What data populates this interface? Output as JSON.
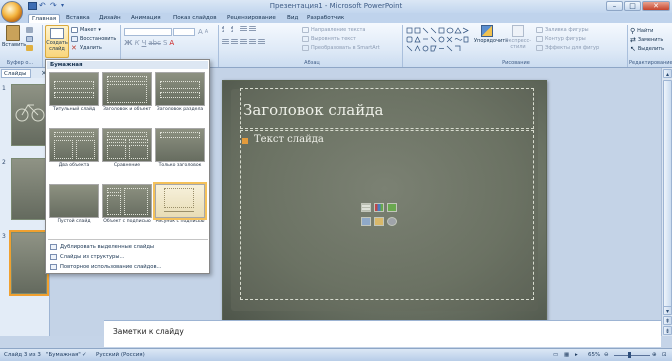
{
  "window": {
    "title": "Презентация1 - Microsoft PowerPoint",
    "controls": [
      "–",
      "□",
      "✕"
    ]
  },
  "tabs": [
    "Главная",
    "Вставка",
    "Дизайн",
    "Анимация",
    "Показ слайдов",
    "Рецензирование",
    "Вид",
    "Разработчик"
  ],
  "ribbon": {
    "clipboard": {
      "paste": "Вставить",
      "label": "Буфер о..."
    },
    "slides": {
      "new_slide": "Создать\nслайд",
      "layout": "Макет",
      "restore": "Восстановить",
      "delete": "Удалить"
    },
    "font": {
      "family_value": "",
      "size_value": ""
    },
    "paragraph": {
      "label": "Абзац",
      "text_direction": "Направление текста",
      "align_text": "Выровнять текст",
      "convert_smartart": "Преобразовать в SmartArt"
    },
    "drawing": {
      "label": "Рисование",
      "arrange": "Упорядочить",
      "quick_styles": "Экспресс-стили",
      "shape_fill": "Заливка фигуры",
      "shape_outline": "Контур фигуры",
      "shape_effects": "Эффекты для фигур"
    },
    "editing": {
      "label": "Редактирование",
      "find": "Найти",
      "replace": "Заменить",
      "select": "Выделить"
    }
  },
  "left_panel": {
    "tab_slides": "Слайды",
    "thumb_numbers": [
      "1",
      "2",
      "3"
    ]
  },
  "slide": {
    "title": "Заголовок слайда",
    "body": "Текст слайда"
  },
  "notes": {
    "placeholder": "Заметки к слайду"
  },
  "status": {
    "slide_pos": "Слайд 3 из 3",
    "theme": "\"Бумажная\"",
    "language": "Русский (Россия)",
    "zoom": "65%"
  },
  "dropdown": {
    "header": "Бумажная",
    "layouts": [
      {
        "label": "Титульный слайд"
      },
      {
        "label": "Заголовок и объект"
      },
      {
        "label": "Заголовок раздела"
      },
      {
        "label": "Два объекта"
      },
      {
        "label": "Сравнение"
      },
      {
        "label": "Только заголовок"
      },
      {
        "label": "Пустой слайд"
      },
      {
        "label": "Объект с подписью"
      },
      {
        "label": "Рисунок с подписью"
      }
    ],
    "actions": [
      "Дублировать выделенные слайды",
      "Слайды из структуры...",
      "Повторное использование слайдов..."
    ]
  },
  "colors": {
    "accent_orange": "#f0a030",
    "ribbon_blue": "#dfeaf7",
    "slide_bg": "#6e7667",
    "bullet": "#e39b3c"
  }
}
